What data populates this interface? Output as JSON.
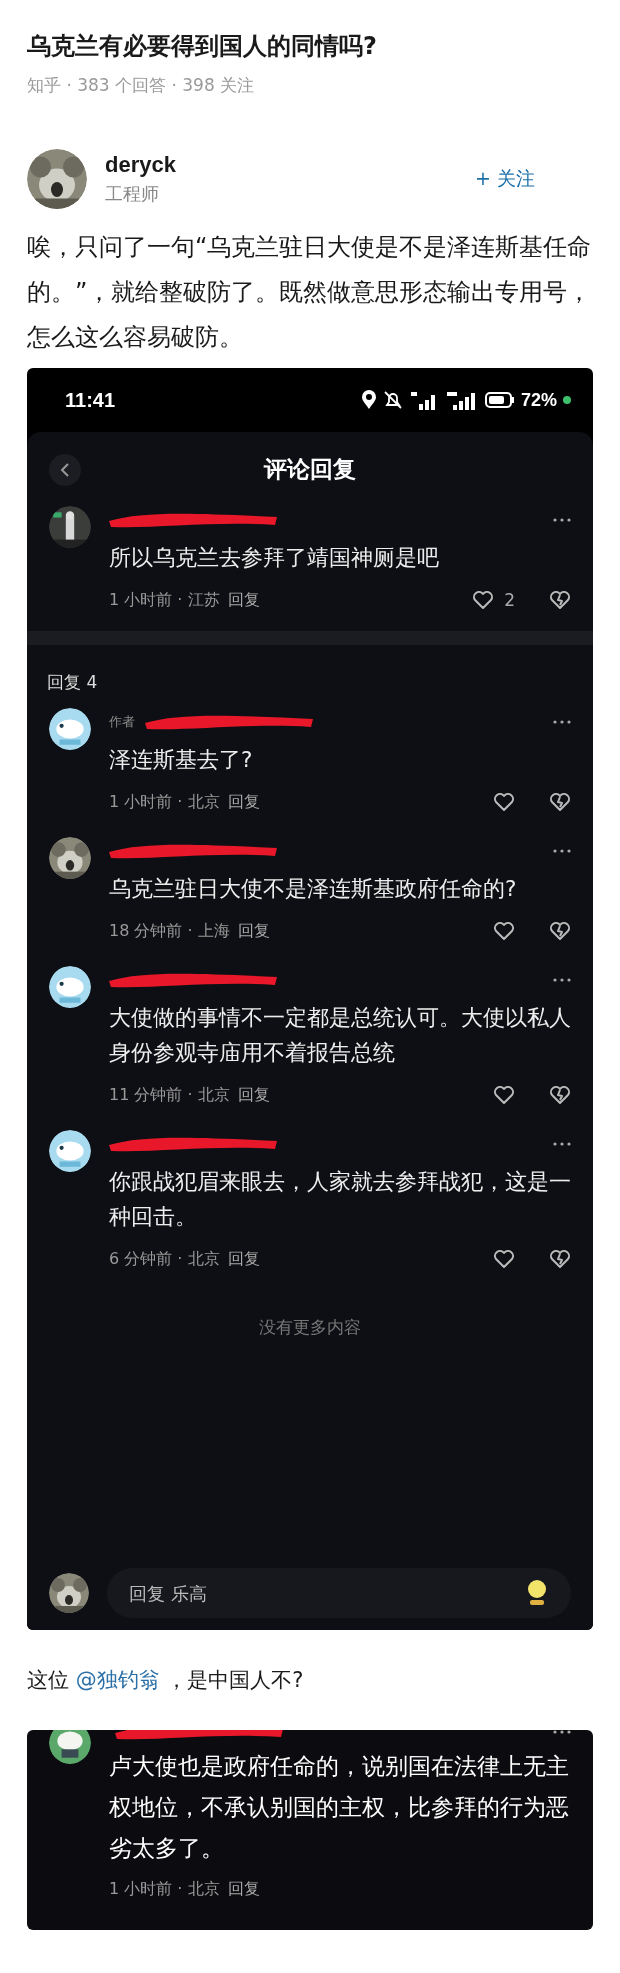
{
  "question": {
    "title": "乌克兰有必要得到国人的同情吗?",
    "meta": "知乎 · 383 个回答 · 398 关注"
  },
  "answer": {
    "author": {
      "name": "deryck",
      "title": "工程师",
      "follow_label": "+ 关注"
    },
    "paragraph": "唉，只问了一句“乌克兰驻日大使是不是泽连斯基任命的。”，就给整破防了。既然做意思形态输出专用号，怎么这么容易破防。"
  },
  "screenshot": {
    "status_bar": {
      "time": "11:41",
      "battery": "72%"
    },
    "title": "评论回复",
    "parent_comment": {
      "redacted": true,
      "text": "所以乌克兰去参拜了靖国神厕是吧",
      "meta": "1 小时前 · 江苏",
      "reply_label": "回复",
      "likes": "2"
    },
    "reply_count": "回复 4",
    "replies": [
      {
        "tag": "作者",
        "redacted": true,
        "text": "泽连斯基去了?",
        "meta": "1 小时前 · 北京",
        "reply_label": "回复"
      },
      {
        "redacted": true,
        "text": "乌克兰驻日大使不是泽连斯基政府任命的?",
        "meta": "18 分钟前 · 上海",
        "reply_label": "回复"
      },
      {
        "redacted": true,
        "text": "大使做的事情不一定都是总统认可。大使以私人身份参观寺庙用不着报告总统",
        "meta": "11 分钟前 · 北京",
        "reply_label": "回复"
      },
      {
        "redacted": true,
        "text": "你跟战犯眉来眼去，人家就去参拜战犯，这是一种回击。",
        "meta": "6 分钟前 · 北京",
        "reply_label": "回复"
      }
    ],
    "end_text": "没有更多内容",
    "input": {
      "placeholder": "回复 乐高"
    }
  },
  "mention_paragraph": {
    "before": "这位",
    "mention": "@独钓翁",
    "after": "，是中国人不?"
  },
  "comment_card": {
    "redacted": true,
    "text": "卢大使也是政府任命的，说别国在法律上无主权地位，不承认别国的主权，比参拜的行为恶劣太多了。",
    "meta": "1 小时前 · 北京",
    "reply_label": "回复"
  }
}
